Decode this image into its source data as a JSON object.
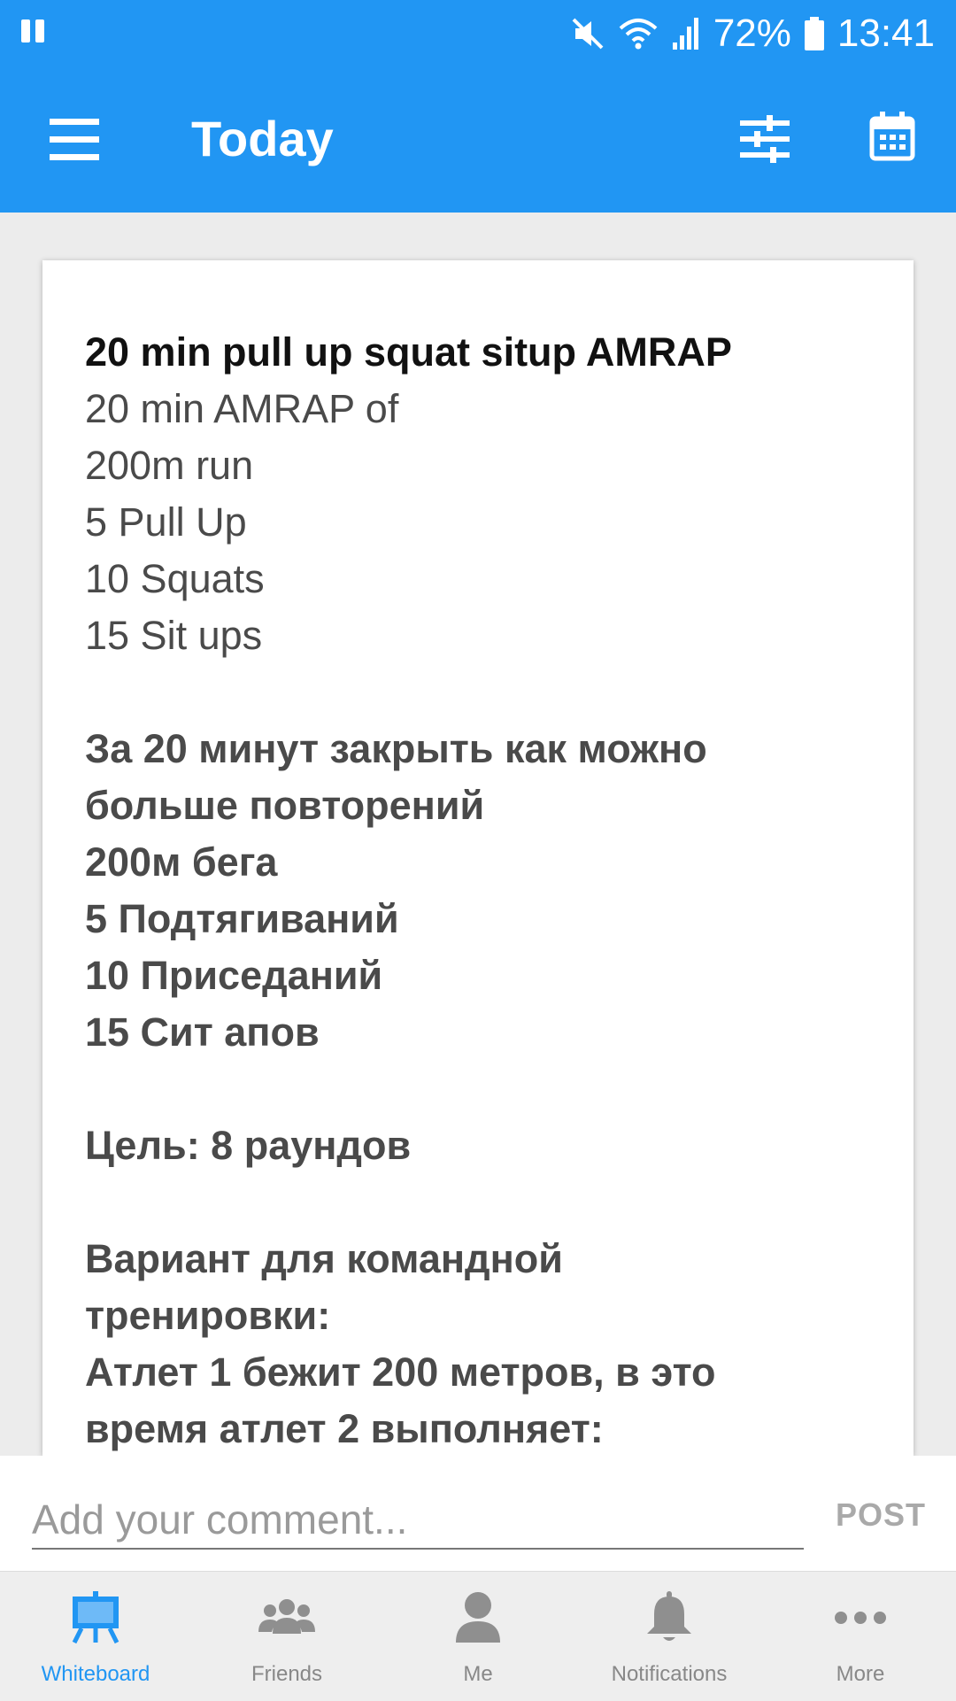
{
  "status_bar": {
    "battery": "72%",
    "time": "13:41"
  },
  "app_bar": {
    "title": "Today"
  },
  "workout": {
    "title": "20 min pull up squat situp AMRAP",
    "lines": [
      "20 min AMRAP of",
      "200m run",
      "5 Pull Up",
      "10 Squats",
      "15 Sit ups",
      "",
      "За 20 минут закрыть как можно",
      "больше повторений",
      "200м бега",
      "5 Подтягиваний",
      "10 Приседаний",
      "15 Сит апов",
      "",
      "Цель: 8 раундов",
      "",
      "Вариант для командной",
      "тренировки:",
      "Атлет 1 бежит 200 метров, в это",
      "время атлет 2 выполняет:"
    ]
  },
  "comment": {
    "placeholder": "Add your comment...",
    "post_label": "POST"
  },
  "bottom_nav": {
    "items": [
      {
        "label": "Whiteboard",
        "icon": "whiteboard-icon",
        "active": true
      },
      {
        "label": "Friends",
        "icon": "friends-icon",
        "active": false
      },
      {
        "label": "Me",
        "icon": "person-icon",
        "active": false
      },
      {
        "label": "Notifications",
        "icon": "bell-icon",
        "active": false
      },
      {
        "label": "More",
        "icon": "more-dots-icon",
        "active": false
      }
    ]
  },
  "colors": {
    "primary": "#2196f3",
    "nav_inactive": "#888888"
  }
}
